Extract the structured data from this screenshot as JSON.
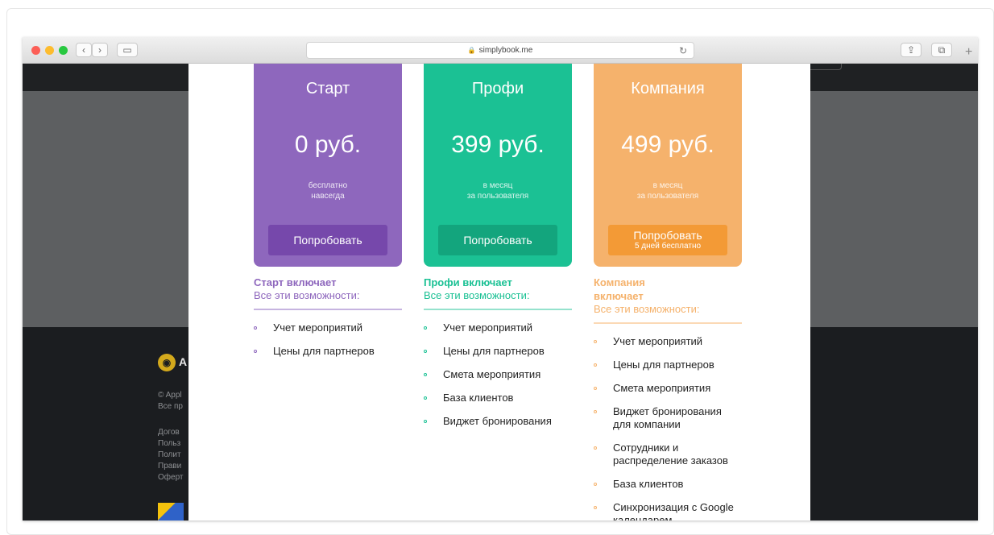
{
  "browser": {
    "url": "simplybook.me",
    "buttons": {
      "back": "‹",
      "forward": "›",
      "sidebar": "▭",
      "share": "⇪",
      "tabs": "⧉",
      "new_tab": "+",
      "reload": "↻",
      "lock": "🔒"
    },
    "traffic_lights": {
      "close": "#fc5f57",
      "minimize": "#fdbc2e",
      "zoom": "#28c840"
    }
  },
  "background_site": {
    "logo_letter": "A",
    "footer_lines": [
      "© Appl",
      "Все пр"
    ],
    "footer_links": [
      "Догов",
      "Польз",
      "Полит",
      "Прави",
      "Оферт"
    ]
  },
  "plans": [
    {
      "name": "Старт",
      "price": "0 руб.",
      "note_line1": "бесплатно",
      "note_line2": "навсегда",
      "button_label": "Попробовать",
      "button_sub": "",
      "color": "#8e67bd",
      "button_color": "#7648ab",
      "accent": "#8e67bd",
      "rule_color": "#c6b4e0",
      "includes_title": "Старт включает",
      "includes_sub": "Все эти возможности:",
      "features": [
        "Учет мероприятий",
        "Цены для партнеров"
      ]
    },
    {
      "name": "Профи",
      "price": "399 руб.",
      "note_line1": "в месяц",
      "note_line2": "за пользователя",
      "button_label": "Попробовать",
      "button_sub": "",
      "color": "#1bc194",
      "button_color": "#13a57d",
      "accent": "#1bc194",
      "rule_color": "#95e2cd",
      "includes_title": "Профи включает",
      "includes_sub": "Все эти возможности:",
      "features": [
        "Учет мероприятий",
        "Цены для партнеров",
        "Смета мероприятия",
        "База клиентов",
        "Виджет бронирования"
      ]
    },
    {
      "name": "Компания",
      "price": "499 руб.",
      "note_line1": "в месяц",
      "note_line2": "за пользователя",
      "button_label": "Попробовать",
      "button_sub": "5 дней бесплатно",
      "color": "#f5b26c",
      "button_color": "#f39a36",
      "accent": "#f5b26c",
      "rule_color": "#fbd9b5",
      "includes_title": "Компания включает",
      "includes_sub": "Все эти возможности:",
      "features": [
        "Учет мероприятий",
        "Цены для партнеров",
        "Смета мероприятия",
        "Виджет бронирования для компании",
        "Сотрудники и распределение заказов",
        "База клиентов",
        "Синхронизация с Google календарем"
      ]
    }
  ]
}
